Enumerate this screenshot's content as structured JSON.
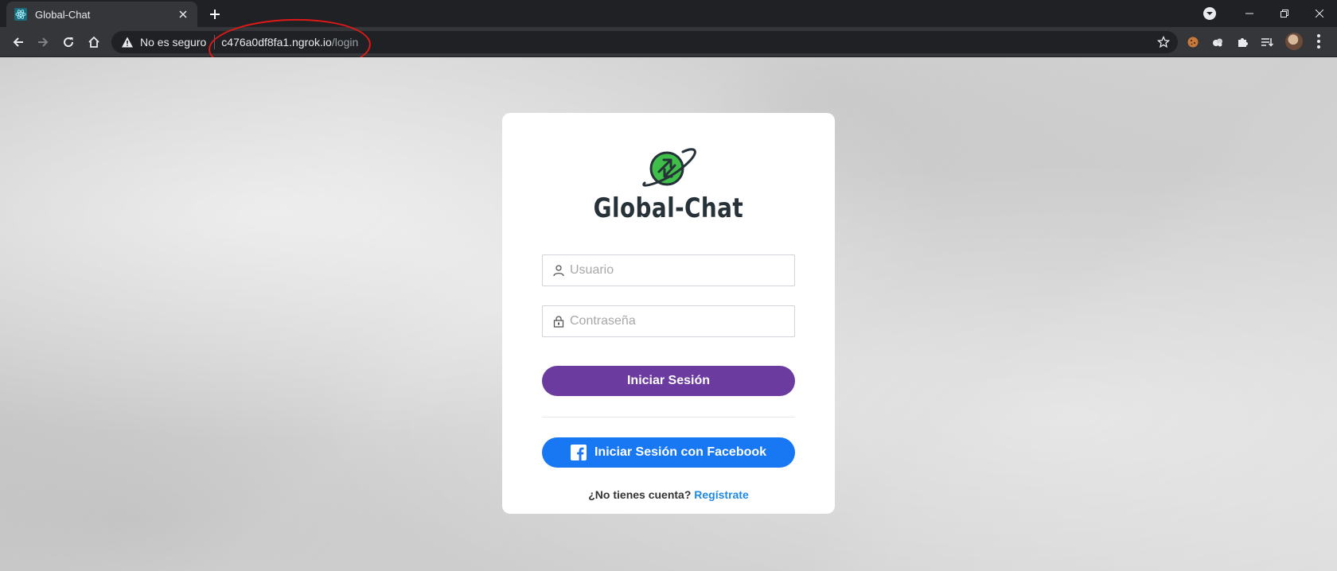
{
  "browser": {
    "tab": {
      "title": "Global-Chat",
      "favicon": "react-atom-icon"
    },
    "new_tab": "+",
    "omnibox": {
      "security_label": "No es seguro",
      "url_host": "c476a0df8fa1.ngrok.io",
      "url_path": "/login"
    },
    "annotation_color": "#e01818"
  },
  "login": {
    "brand_name": "Global-Chat",
    "brand_color": "#263238",
    "accent_green": "#3fbf4a",
    "username_placeholder": "Usuario",
    "password_placeholder": "Contraseña",
    "login_button": "Iniciar Sesión",
    "login_button_color": "#6b3ba0",
    "facebook_button": "Iniciar Sesión con Facebook",
    "facebook_button_color": "#1877f2",
    "signup_prompt": "¿No tienes cuenta?",
    "signup_link": "Regístrate",
    "signup_link_color": "#1e88e5"
  }
}
